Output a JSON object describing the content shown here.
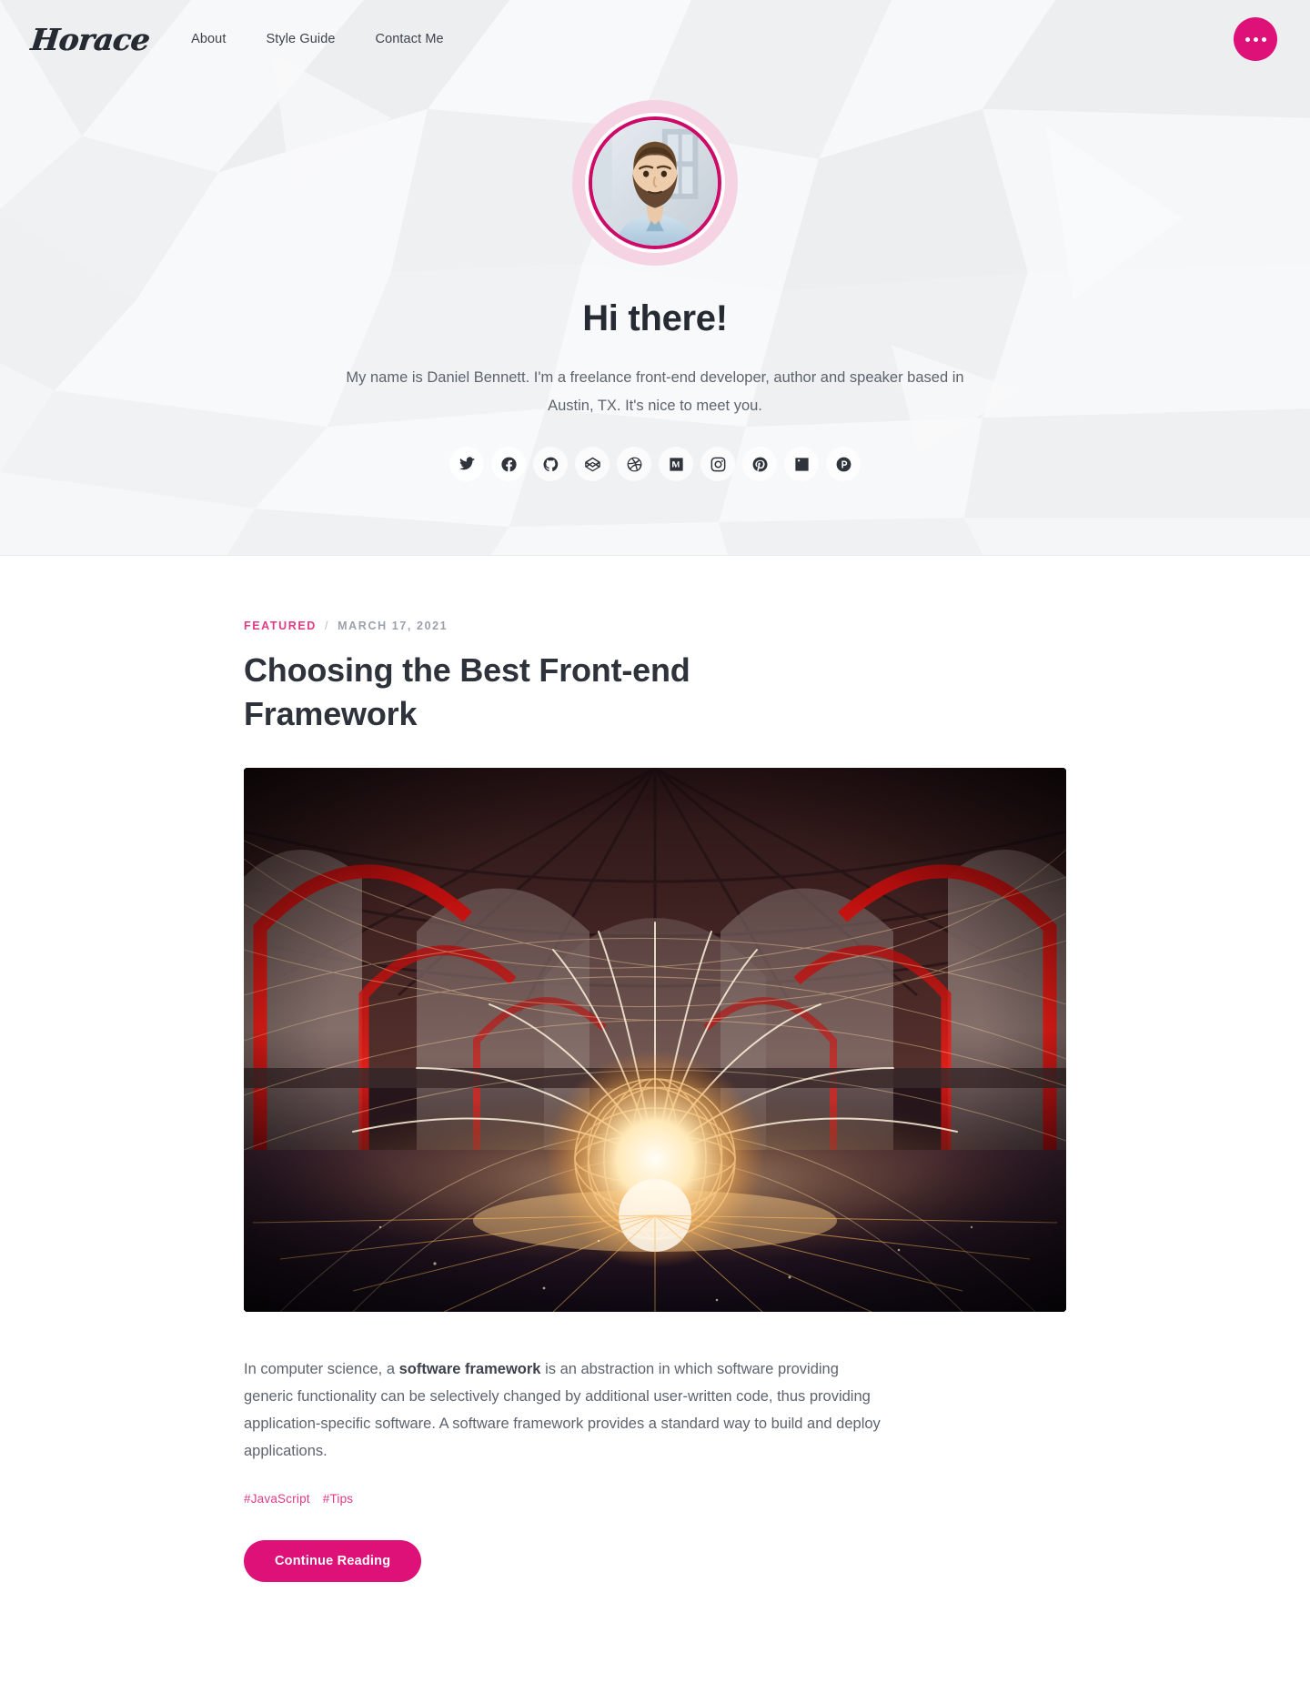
{
  "brand": {
    "logo": "Horace"
  },
  "nav": {
    "items": [
      {
        "label": "About"
      },
      {
        "label": "Style Guide"
      },
      {
        "label": "Contact Me"
      }
    ],
    "more_button_label": "More"
  },
  "profile": {
    "avatar_alt": "Daniel Bennett portrait",
    "greeting": "Hi there!",
    "bio": "My name is Daniel Bennett. I'm a freelance front-end developer, author and speaker based in Austin, TX. It's nice to meet you.",
    "socials": [
      {
        "name": "twitter-icon",
        "label": "Twitter"
      },
      {
        "name": "facebook-icon",
        "label": "Facebook"
      },
      {
        "name": "github-icon",
        "label": "GitHub"
      },
      {
        "name": "codepen-icon",
        "label": "CodePen"
      },
      {
        "name": "dribbble-icon",
        "label": "Dribbble"
      },
      {
        "name": "medium-icon",
        "label": "Medium"
      },
      {
        "name": "instagram-icon",
        "label": "Instagram"
      },
      {
        "name": "pinterest-icon",
        "label": "Pinterest"
      },
      {
        "name": "linkedin-icon",
        "label": "LinkedIn"
      },
      {
        "name": "producthunt-icon",
        "label": "Product Hunt"
      }
    ]
  },
  "featured_post": {
    "category": "FEATURED",
    "separator": "/",
    "date": "MARCH 17, 2021",
    "title": "Choosing the Best Front-end Framework",
    "image_alt": "Steel wool light painting sphere inside a red-lit stone vaulted hall",
    "excerpt_lead": "In computer science, a ",
    "excerpt_bold": "software framework",
    "excerpt_rest": " is an abstraction in which software providing generic functionality can be selectively changed by additional user-written code, thus providing application-specific software. A software framework provides a standard way to build and deploy applications.",
    "tags": [
      {
        "label": "#JavaScript"
      },
      {
        "label": "#Tips"
      }
    ],
    "cta_label": "Continue Reading"
  },
  "colors": {
    "accent": "#dd1177",
    "accent_soft": "#dd3b86",
    "heading": "#2d323b",
    "body_text": "#5d646e",
    "hero_bg": "#f4f5f6"
  }
}
